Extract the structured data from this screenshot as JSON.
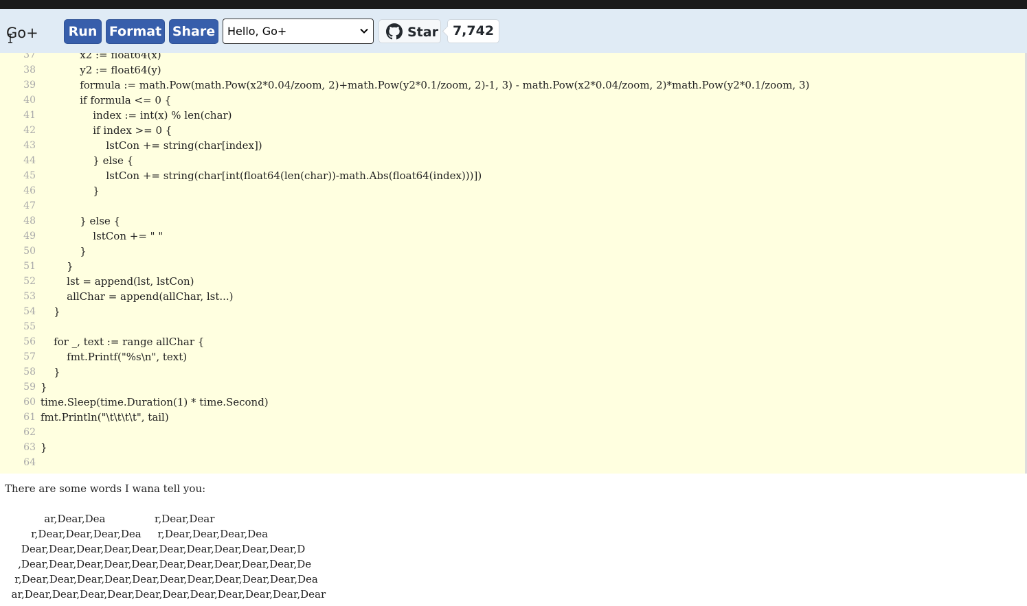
{
  "header": {
    "logo": "Go+",
    "run_label": "Run",
    "format_label": "Format",
    "share_label": "Share",
    "example_select": "Hello, Go+",
    "star_label": "Star",
    "star_count": "7,742"
  },
  "editor": {
    "lines": [
      {
        "n": "37",
        "t": "            x2 := float64(x)"
      },
      {
        "n": "38",
        "t": "            y2 := float64(y)"
      },
      {
        "n": "39",
        "t": "            formula := math.Pow(math.Pow(x2*0.04/zoom, 2)+math.Pow(y2*0.1/zoom, 2)-1, 3) - math.Pow(x2*0.04/zoom, 2)*math.Pow(y2*0.1/zoom, 3)"
      },
      {
        "n": "40",
        "t": "            if formula <= 0 {"
      },
      {
        "n": "41",
        "t": "                index := int(x) % len(char)"
      },
      {
        "n": "42",
        "t": "                if index >= 0 {"
      },
      {
        "n": "43",
        "t": "                    lstCon += string(char[index])"
      },
      {
        "n": "44",
        "t": "                } else {"
      },
      {
        "n": "45",
        "t": "                    lstCon += string(char[int(float64(len(char))-math.Abs(float64(index)))])"
      },
      {
        "n": "46",
        "t": "                }"
      },
      {
        "n": "47",
        "t": ""
      },
      {
        "n": "48",
        "t": "            } else {"
      },
      {
        "n": "49",
        "t": "                lstCon += \" \""
      },
      {
        "n": "50",
        "t": "            }"
      },
      {
        "n": "51",
        "t": "        }"
      },
      {
        "n": "52",
        "t": "        lst = append(lst, lstCon)"
      },
      {
        "n": "53",
        "t": "        allChar = append(allChar, lst...)"
      },
      {
        "n": "54",
        "t": "    }"
      },
      {
        "n": "55",
        "t": ""
      },
      {
        "n": "56",
        "t": "    for _, text := range allChar {"
      },
      {
        "n": "57",
        "t": "        fmt.Printf(\"%s\\n\", text)"
      },
      {
        "n": "58",
        "t": "    }"
      },
      {
        "n": "59",
        "t": "}"
      },
      {
        "n": "60",
        "t": "time.Sleep(time.Duration(1) * time.Second)"
      },
      {
        "n": "61",
        "t": "fmt.Println(\"\\t\\t\\t\\t\", tail)"
      },
      {
        "n": "62",
        "t": ""
      },
      {
        "n": "63",
        "t": "}"
      },
      {
        "n": "64",
        "t": ""
      }
    ]
  },
  "output": {
    "lines": [
      "There are some words I wana tell you:",
      "",
      "            ar,Dear,Dea               r,Dear,Dear",
      "        r,Dear,Dear,Dear,Dea     r,Dear,Dear,Dear,Dea",
      "     Dear,Dear,Dear,Dear,Dear,Dear,Dear,Dear,Dear,Dear,D",
      "    ,Dear,Dear,Dear,Dear,Dear,Dear,Dear,Dear,Dear,Dear,De",
      "   r,Dear,Dear,Dear,Dear,Dear,Dear,Dear,Dear,Dear,Dear,Dea",
      "  ar,Dear,Dear,Dear,Dear,Dear,Dear,Dear,Dear,Dear,Dear,Dear"
    ]
  }
}
